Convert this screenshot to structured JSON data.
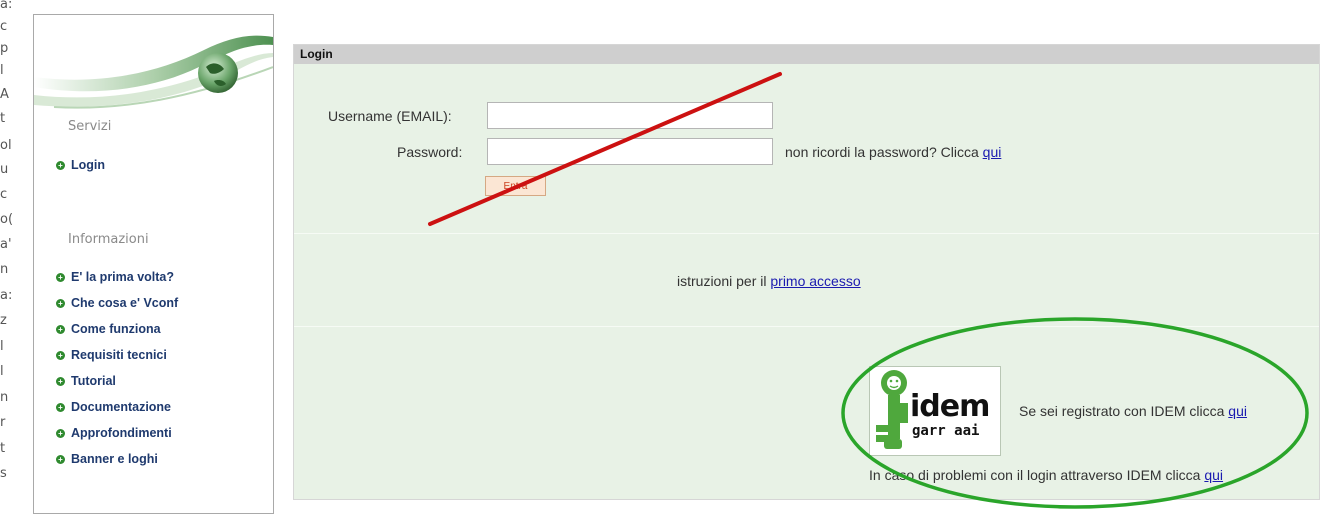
{
  "edge_letters": [
    "a:",
    "c",
    "p",
    "l",
    "A",
    "t",
    "ol",
    "u",
    "c",
    "o(",
    "a'",
    "n",
    "a:",
    "z",
    "l",
    "l",
    "n",
    "r",
    "t",
    "s"
  ],
  "sidebar": {
    "section_servizi": "Servizi",
    "servizi_items": [
      {
        "label": "Login"
      }
    ],
    "section_info": "Informazioni",
    "info_items": [
      {
        "label": "E' la prima volta?"
      },
      {
        "label": "Che cosa e' Vconf"
      },
      {
        "label": "Come funziona"
      },
      {
        "label": "Requisiti tecnici"
      },
      {
        "label": "Tutorial"
      },
      {
        "label": "Documentazione"
      },
      {
        "label": "Approfondimenti"
      },
      {
        "label": "Banner e loghi"
      }
    ]
  },
  "login": {
    "header": "Login",
    "username_label": "Username (EMAIL):",
    "username_value": "",
    "password_label": "Password:",
    "password_value": "",
    "forgot_text": "non ricordi la password? Clicca",
    "forgot_link": "qui",
    "submit_label": "Entra"
  },
  "first_access": {
    "text": "istruzioni per il",
    "link": "primo accesso"
  },
  "idem": {
    "logo_text_main": "idem",
    "logo_text_sub": "garr aai",
    "registered_text": "Se sei registrato con IDEM clicca",
    "registered_link": "qui",
    "problems_text": "In caso di problemi con il login attraverso IDEM clicca",
    "problems_link": "qui"
  },
  "colors": {
    "panel_bg": "#e8f2e6",
    "header_bg": "#cfcfcf",
    "nav_text": "#1f3a6e",
    "bullet": "#2f8a2f",
    "link": "#1a1ab0",
    "annotation_red": "#cc1111",
    "annotation_green": "#2aa52a"
  }
}
